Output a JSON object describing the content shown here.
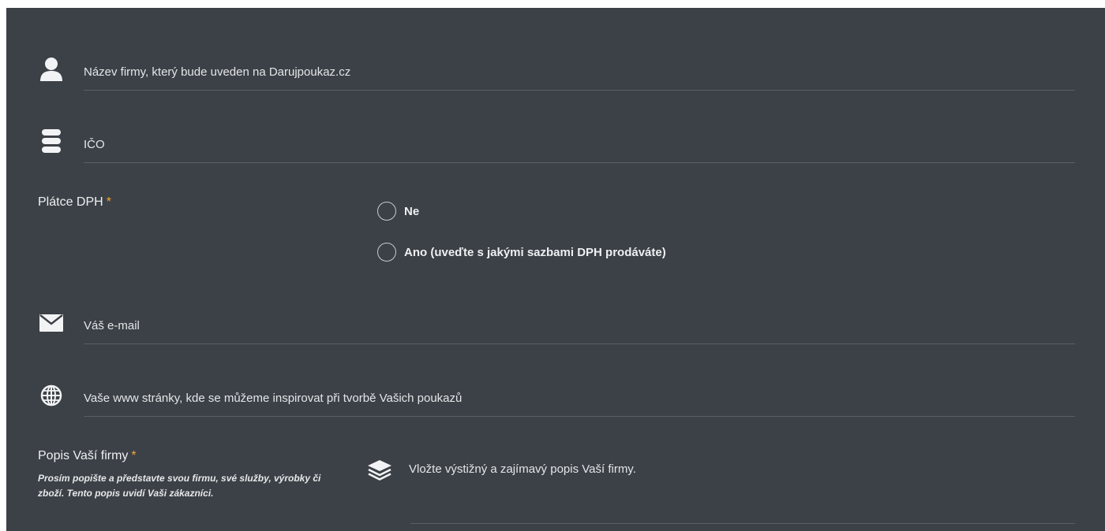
{
  "form": {
    "company_name": {
      "placeholder": "Název firmy, který bude uveden na Darujpoukaz.cz",
      "value": ""
    },
    "ico": {
      "placeholder": "IČO",
      "value": ""
    },
    "vat_payer": {
      "label": "Plátce DPH",
      "required_mark": "*",
      "options": [
        {
          "label": "Ne",
          "selected": false
        },
        {
          "label": "Ano (uveďte s jakými sazbami DPH prodáváte)",
          "selected": false
        }
      ]
    },
    "email": {
      "placeholder": "Váš e-mail",
      "value": ""
    },
    "website": {
      "placeholder": "Vaše www stránky, kde se můžeme inspirovat při tvorbě Vašich poukazů",
      "value": ""
    },
    "description": {
      "label": "Popis Vaší firmy",
      "required_mark": "*",
      "hint": "Prosím popište a představte svou firmu, své služby, výrobky či zboží. Tento popis uvidí Vaši zákazníci.",
      "placeholder": "Vložte výstižný a zajímavý popis Vaší firmy.",
      "value": ""
    }
  },
  "icons": {
    "company_name": "user-icon",
    "ico": "database-icon",
    "email": "envelope-icon",
    "website": "globe-icon",
    "description": "layers-icon"
  },
  "colors": {
    "panel_background": "#3c4147",
    "required_accent": "#f4a637",
    "text": "#eef0f2"
  }
}
